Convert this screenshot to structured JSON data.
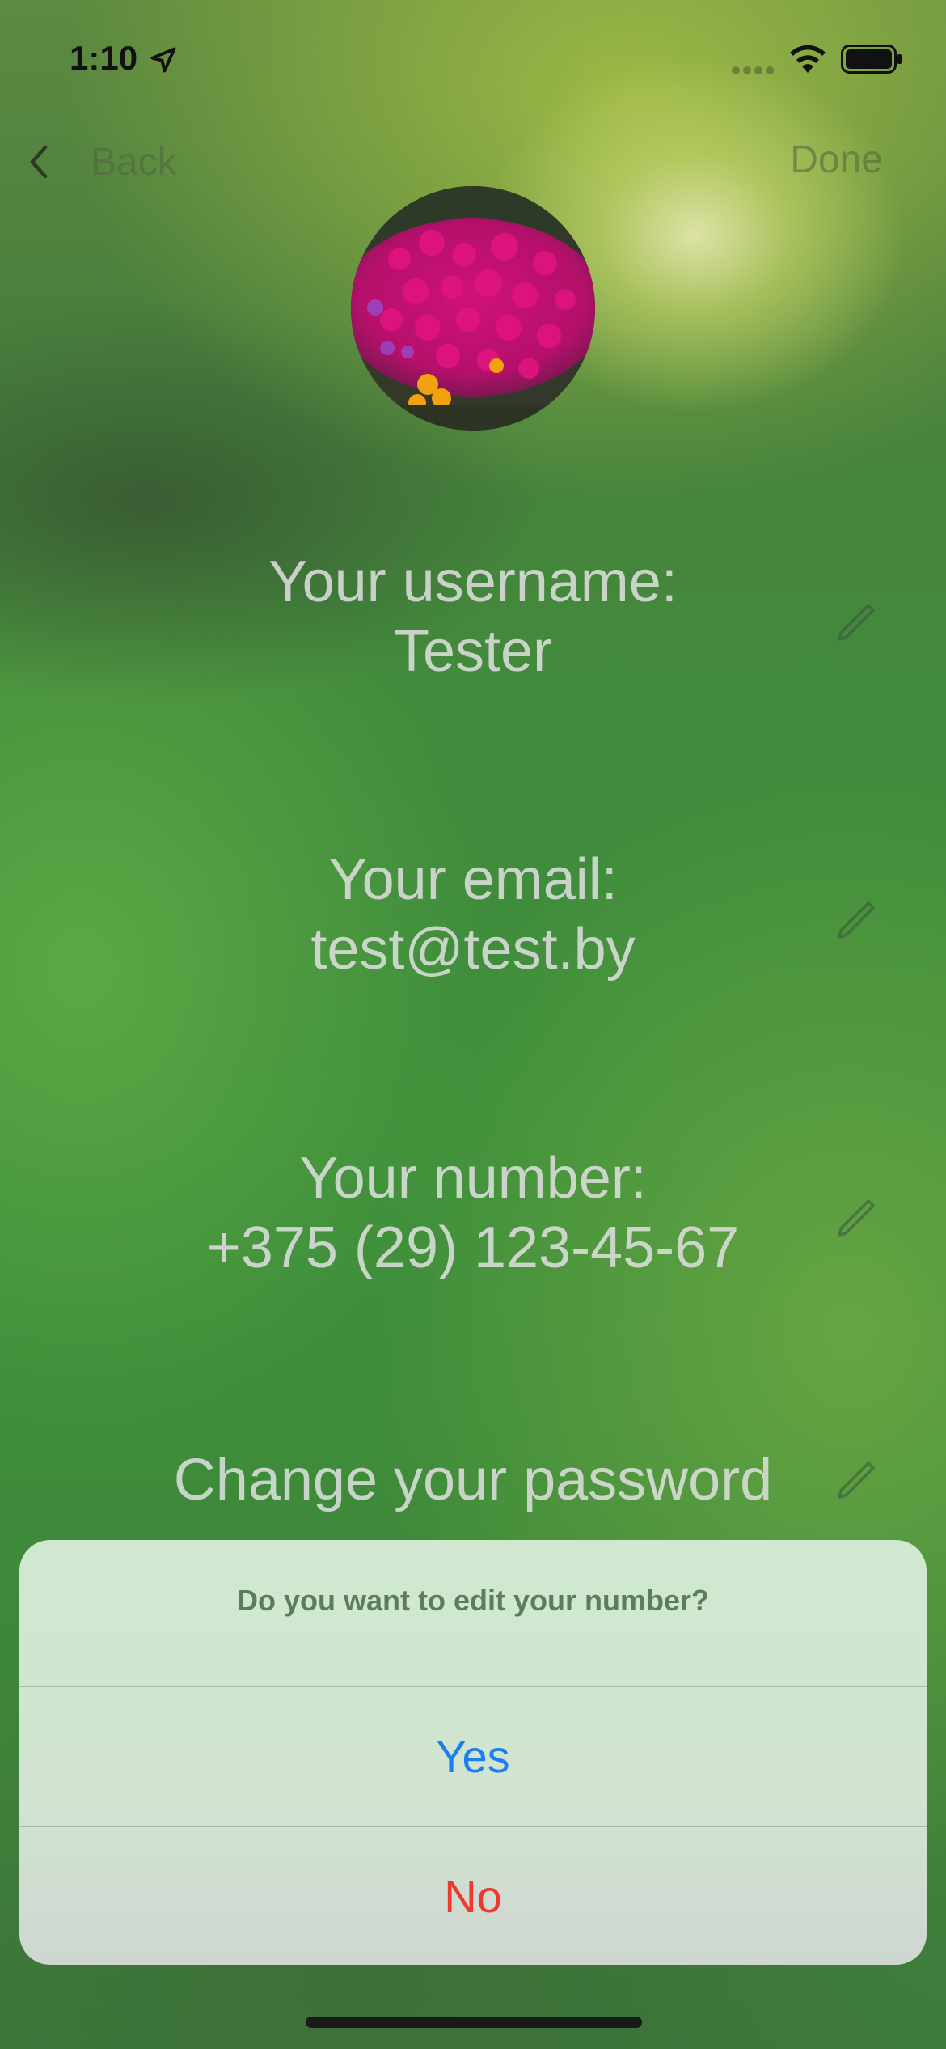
{
  "status_bar": {
    "time": "1:10"
  },
  "nav": {
    "back_label": "Back",
    "done_label": "Done"
  },
  "profile": {
    "username_label": "Your username:",
    "username_value": "Tester",
    "email_label": "Your email:",
    "email_value": "test@test.by",
    "number_label": "Your number:",
    "number_value": "+375 (29) 123-45-67",
    "password_label": "Change your password"
  },
  "action_sheet": {
    "title": "Do you want to edit your number?",
    "yes_label": "Yes",
    "no_label": "No"
  },
  "colors": {
    "yes": "#1d7ef2",
    "no": "#f0392e"
  }
}
